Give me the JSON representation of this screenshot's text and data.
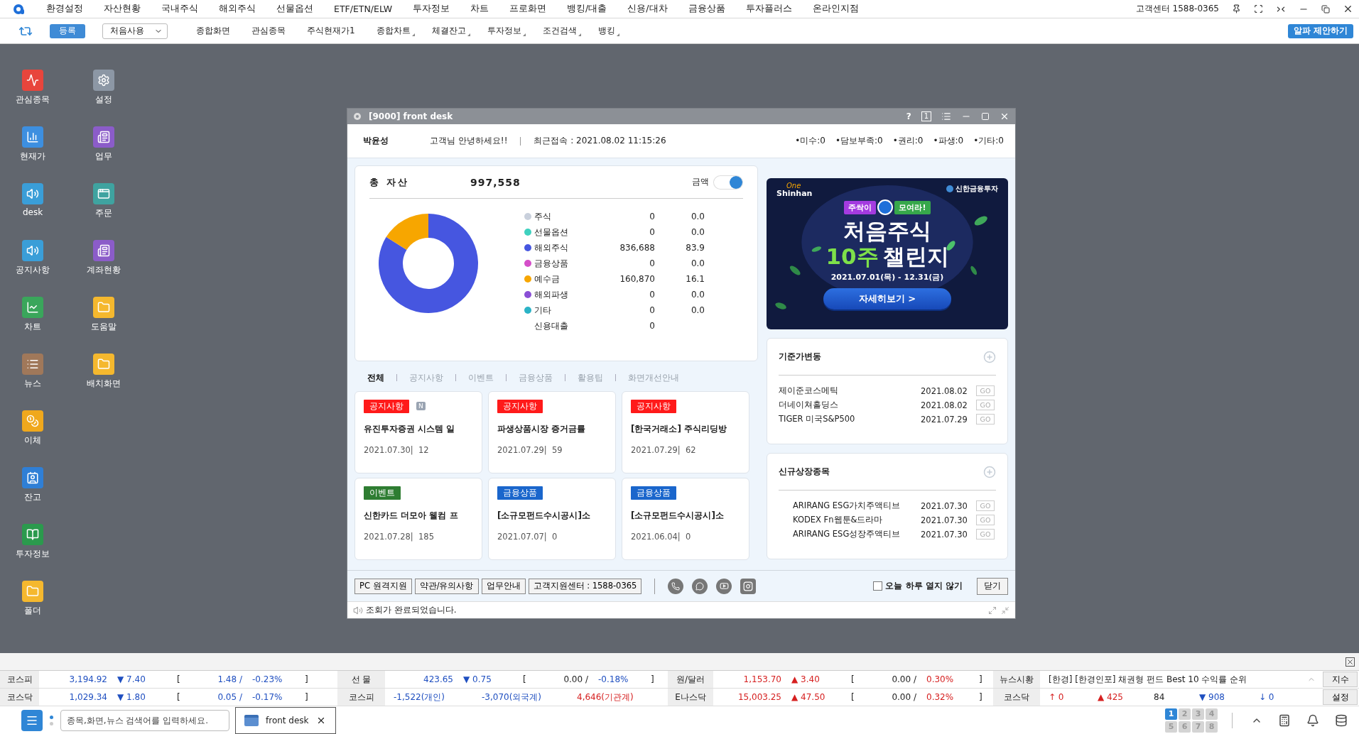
{
  "menu_bar": {
    "items": [
      "환경설정",
      "자산현황",
      "국내주식",
      "해외주식",
      "선물옵션",
      "ETF/ETN/ELW",
      "투자정보",
      "차트",
      "프로화면",
      "뱅킹/대출",
      "신용/대차",
      "금융상품",
      "투자플러스",
      "온라인지점"
    ],
    "support": "고객센터 1588-0365"
  },
  "toolbar": {
    "register": "등록",
    "profile": "처음사용",
    "items": [
      {
        "label": "종합화면",
        "submenu": false
      },
      {
        "label": "관심종목",
        "submenu": false
      },
      {
        "label": "주식현재가1",
        "submenu": false
      },
      {
        "label": "종합차트",
        "submenu": true
      },
      {
        "label": "체결잔고",
        "submenu": true
      },
      {
        "label": "투자정보",
        "submenu": true
      },
      {
        "label": "조건검색",
        "submenu": true
      },
      {
        "label": "뱅킹",
        "submenu": true
      }
    ],
    "suggest": "알파 제안하기"
  },
  "desktop_icons": [
    {
      "label": "관심종목",
      "kind": "watch"
    },
    {
      "label": "현재가",
      "kind": "price"
    },
    {
      "label": "desk",
      "kind": "desk"
    },
    {
      "label": "공지사항",
      "kind": "notice"
    },
    {
      "label": "차트",
      "kind": "chart"
    },
    {
      "label": "뉴스",
      "kind": "news"
    },
    {
      "label": "이체",
      "kind": "transfer"
    },
    {
      "label": "잔고",
      "kind": "balance"
    },
    {
      "label": "투자정보",
      "kind": "invest"
    },
    {
      "label": "폴더",
      "kind": "folder"
    },
    {
      "label": "설정",
      "kind": "settings"
    },
    {
      "label": "업무",
      "kind": "work"
    },
    {
      "label": "주문",
      "kind": "order"
    },
    {
      "label": "계좌현황",
      "kind": "account"
    },
    {
      "label": "도움말",
      "kind": "folder"
    },
    {
      "label": "배치화면",
      "kind": "folder"
    }
  ],
  "window": {
    "title": "[9000] front desk",
    "help": "?",
    "screen_number": "1",
    "header": {
      "name": "박윤성",
      "greeting": "고객님 안녕하세요!!",
      "last_login": "최근접속 : 2021.08.02 11:15:26",
      "stats": [
        "•미수:0",
        "•담보부족:0",
        "•권리:0",
        "•파생:0",
        "•기타:0"
      ]
    },
    "assets": {
      "title": "총 자산",
      "total": "997,558",
      "toggle": {
        "label": "금액",
        "on": true
      },
      "items": [
        {
          "name": "주식",
          "amount": "0",
          "percent": "0.0",
          "color": "#c9d0dc"
        },
        {
          "name": "선물옵션",
          "amount": "0",
          "percent": "0.0",
          "color": "#3fd1bf"
        },
        {
          "name": "해외주식",
          "amount": "836,688",
          "percent": "83.9",
          "color": "#4656e0"
        },
        {
          "name": "금융상품",
          "amount": "0",
          "percent": "0.0",
          "color": "#d54fc9"
        },
        {
          "name": "예수금",
          "amount": "160,870",
          "percent": "16.1",
          "color": "#f7a600"
        },
        {
          "name": "해외파생",
          "amount": "0",
          "percent": "0.0",
          "color": "#8a4fd6"
        },
        {
          "name": "기타",
          "amount": "0",
          "percent": "0.0",
          "color": "#2bb3c6"
        },
        {
          "name": "신용대출",
          "amount": "0"
        }
      ],
      "chart_data": {
        "type": "donut",
        "values": [
          0,
          0,
          83.9,
          0,
          16.1,
          0,
          0
        ]
      }
    },
    "tabs": [
      {
        "label": "전체",
        "selected": true
      },
      {
        "label": "공지사항",
        "selected": false
      },
      {
        "label": "이벤트",
        "selected": false
      },
      {
        "label": "금융상품",
        "selected": false
      },
      {
        "label": "활용팁",
        "selected": false
      },
      {
        "label": "화면개선안내",
        "selected": false
      }
    ],
    "cards": [
      {
        "tag": "공지사항",
        "kind": "notice",
        "new": "N",
        "title": "유진투자증권 시스템 일",
        "meta": "2021.07.30|  12"
      },
      {
        "tag": "공지사항",
        "kind": "notice",
        "title": "파생상품시장 증거금률",
        "meta": "2021.07.29|  59"
      },
      {
        "tag": "공지사항",
        "kind": "notice",
        "title": "[한국거래소] 주식리딩방",
        "meta": "2021.07.29|  62"
      },
      {
        "tag": "이벤트",
        "kind": "event",
        "title": "신한카드 더모아 웰컴 프",
        "meta": "2021.07.28|  185"
      },
      {
        "tag": "금융상품",
        "kind": "product",
        "title": "[소규모펀드수시공시]소",
        "meta": "2021.07.07|  0"
      },
      {
        "tag": "금융상품",
        "kind": "product",
        "title": "[소규모펀드수시공시]소",
        "meta": "2021.06.04|  0"
      }
    ],
    "banner": {
      "brand_top": "One",
      "brand_bottom": "Shinhan",
      "company": "신한금융투자",
      "tag_left": "주싹이",
      "tag_right": "모여라!",
      "headline": "처음주식",
      "headline_accent": "10주",
      "headline_rest": "챌린지",
      "period": "2021.07.01(목) - 12.31(금)",
      "button": "자세히보기 >"
    },
    "panels": [
      {
        "title": "기준가변동",
        "indent": false,
        "rows": [
          {
            "name": "제이준코스메틱",
            "date": "2021.08.02",
            "action": "GO"
          },
          {
            "name": "더네이쳐홀딩스",
            "date": "2021.08.02",
            "action": "GO"
          },
          {
            "name": "TIGER 미국S&P500",
            "date": "2021.07.29",
            "action": "GO"
          }
        ]
      },
      {
        "title": "신규상장종목",
        "indent": true,
        "rows": [
          {
            "name": "ARIRANG ESG가치주액티브",
            "date": "2021.07.30",
            "action": "GO"
          },
          {
            "name": "KODEX Fn웹툰&드라마",
            "date": "2021.07.30",
            "action": "GO"
          },
          {
            "name": "ARIRANG ESG성장주액티브",
            "date": "2021.07.30",
            "action": "GO"
          }
        ]
      }
    ],
    "footer": {
      "buttons": [
        "PC 원격지원",
        "약관/유의사항",
        "업무안내",
        "고객지원센터 : 1588-0365"
      ],
      "dont_show": {
        "label": "오늘 하루 열지 않기",
        "checked": false
      },
      "close": "닫기"
    },
    "status": "조회가 완료되었습니다."
  },
  "ticker": {
    "rows": [
      {
        "groups": [
          {
            "label": "코스피",
            "cells": [
              {
                "text": "3,194.92",
                "kind": "down"
              },
              {
                "text": "▼ 7.40",
                "kind": "down"
              },
              {
                "text": "[",
                "kind": "plain"
              },
              {
                "text": "1.48 /",
                "kind": "down"
              },
              {
                "text": "-0.23%",
                "kind": "down"
              },
              {
                "text": "]",
                "kind": "plain"
              }
            ]
          },
          {
            "label": "선 물",
            "cells": [
              {
                "text": "423.65",
                "kind": "down"
              },
              {
                "text": "▼ 0.75",
                "kind": "down"
              },
              {
                "text": "[",
                "kind": "plain"
              },
              {
                "text": "0.00 /",
                "kind": "plain"
              },
              {
                "text": "-0.18%",
                "kind": "down"
              },
              {
                "text": "]",
                "kind": "plain"
              }
            ]
          },
          {
            "label": "원/달러",
            "cells": [
              {
                "text": "1,153.70",
                "kind": "up"
              },
              {
                "text": "▲ 3.40",
                "kind": "up"
              },
              {
                "text": "[",
                "kind": "plain"
              },
              {
                "text": "0.00 /",
                "kind": "plain"
              },
              {
                "text": "0.30%",
                "kind": "up"
              },
              {
                "text": "]",
                "kind": "plain"
              }
            ]
          },
          {
            "label": "뉴스시황",
            "cells": [
              {
                "text": "[한경] [한경인포] 채권형 펀드 Best 10 수익률 순위",
                "kind": "plain"
              }
            ]
          }
        ],
        "button": "지수"
      },
      {
        "groups": [
          {
            "label": "코스닥",
            "cells": [
              {
                "text": "1,029.34",
                "kind": "down"
              },
              {
                "text": "▼ 1.80",
                "kind": "down"
              },
              {
                "text": "[",
                "kind": "plain"
              },
              {
                "text": "0.05 /",
                "kind": "down"
              },
              {
                "text": "-0.17%",
                "kind": "down"
              },
              {
                "text": "]",
                "kind": "plain"
              }
            ]
          },
          {
            "label": "코스피",
            "cells": [
              {
                "text": "-1,522(개인)",
                "kind": "down"
              },
              {
                "text": "-3,070(외국계)",
                "kind": "down"
              },
              {
                "text": "4,646(기관계)",
                "kind": "up"
              }
            ]
          },
          {
            "label": "E나스닥",
            "cells": [
              {
                "text": "15,003.25",
                "kind": "up"
              },
              {
                "text": "▲ 47.50",
                "kind": "up"
              },
              {
                "text": "[",
                "kind": "plain"
              },
              {
                "text": "0.00 /",
                "kind": "plain"
              },
              {
                "text": "0.32%",
                "kind": "up"
              },
              {
                "text": "]",
                "kind": "plain"
              }
            ]
          },
          {
            "label": "코스닥",
            "cells": [
              {
                "text": "↑ 0",
                "kind": "up"
              },
              {
                "text": "▲ 425",
                "kind": "up"
              },
              {
                "text": "84",
                "kind": "plain"
              },
              {
                "text": "▼ 908",
                "kind": "down"
              },
              {
                "text": "↓ 0",
                "kind": "down"
              }
            ]
          }
        ],
        "button": "설정"
      }
    ]
  },
  "taskbar": {
    "search_placeholder": "종목,화면,뉴스 검색어를 입력하세요.",
    "open_tab": "front desk",
    "pages": [
      {
        "label": "1",
        "selected": true
      },
      {
        "label": "2",
        "selected": false
      },
      {
        "label": "3",
        "selected": false
      },
      {
        "label": "4",
        "selected": false
      },
      {
        "label": "5",
        "selected": false
      },
      {
        "label": "6",
        "selected": false
      },
      {
        "label": "7",
        "selected": false
      },
      {
        "label": "8",
        "selected": false
      }
    ]
  }
}
